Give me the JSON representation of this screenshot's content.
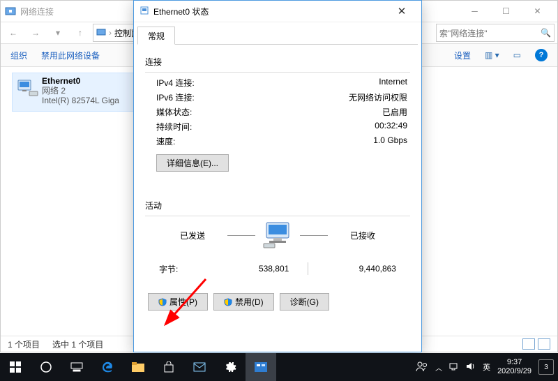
{
  "explorer": {
    "title": "网络连接",
    "breadcrumb": "控制面板",
    "search_placeholder": "索\"网络连接\"",
    "toolbar": {
      "organize": "组织",
      "disable": "禁用此网络设备",
      "right": "设置"
    },
    "adapter": {
      "name": "Ethernet0",
      "sub1": "网络 2",
      "sub2": "Intel(R) 82574L Giga"
    },
    "status_left": "1 个项目",
    "status_sel": "选中 1 个项目"
  },
  "dialog": {
    "title": "Ethernet0 状态",
    "tab": "常规",
    "section_conn": "连接",
    "section_activity": "活动",
    "ipv4_label": "IPv4 连接:",
    "ipv4_value": "Internet",
    "ipv6_label": "IPv6 连接:",
    "ipv6_value": "无网络访问权限",
    "media_label": "媒体状态:",
    "media_value": "已启用",
    "dur_label": "持续时间:",
    "dur_value": "00:32:49",
    "speed_label": "速度:",
    "speed_value": "1.0 Gbps",
    "details_btn": "详细信息(E)...",
    "sent": "已发送",
    "recv": "已接收",
    "bytes_label": "字节:",
    "bytes_sent": "538,801",
    "bytes_recv": "9,440,863",
    "btn_props": "属性(P)",
    "btn_disable": "禁用(D)",
    "btn_diag": "诊断(G)"
  },
  "taskbar": {
    "ime": "英",
    "time": "9:37",
    "date": "2020/9/29",
    "badge": "3"
  }
}
